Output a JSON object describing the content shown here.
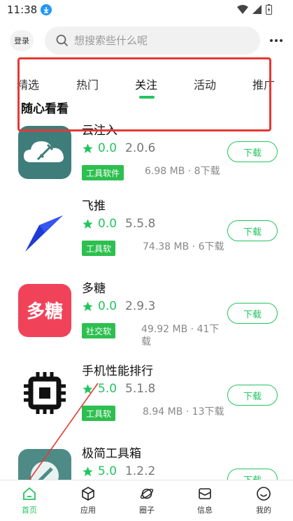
{
  "status_bar": {
    "time": "11:38"
  },
  "header": {
    "login_label": "登录",
    "search_placeholder": "想搜索些什么呢"
  },
  "tabs": [
    {
      "label": "精选",
      "active": false
    },
    {
      "label": "热门",
      "active": false
    },
    {
      "label": "关注",
      "active": true
    },
    {
      "label": "活动",
      "active": false
    },
    {
      "label": "推广",
      "active": false
    }
  ],
  "section_title": "随心看看",
  "apps": [
    {
      "name": "云注入",
      "rating": "0.0",
      "version": "2.0.6",
      "category": "工具软件",
      "meta": "6.98 MB · 8下载",
      "download_label": "下载"
    },
    {
      "name": "飞推",
      "rating": "0.0",
      "version": "5.5.8",
      "category": "工具软",
      "meta": "74.38 MB · 6下载",
      "download_label": "下载"
    },
    {
      "name": "多糖",
      "rating": "0.0",
      "version": "2.9.3",
      "category": "社交软",
      "meta": "49.92 MB · 41下载",
      "download_label": "下载"
    },
    {
      "name": "手机性能排行",
      "rating": "5.0",
      "version": "5.1.8",
      "category": "工具软",
      "meta": "8.94 MB · 13下载",
      "download_label": "下载"
    },
    {
      "name": "极简工具箱",
      "rating": "5.0",
      "version": "1.2.2",
      "category": "",
      "meta": "",
      "download_label": "下载"
    }
  ],
  "bottom_nav": [
    {
      "label": "首页",
      "icon": "home-icon",
      "active": true
    },
    {
      "label": "应用",
      "icon": "cube-icon",
      "active": false
    },
    {
      "label": "圈子",
      "icon": "planet-icon",
      "active": false
    },
    {
      "label": "信息",
      "icon": "mail-icon",
      "active": false
    },
    {
      "label": "我的",
      "icon": "smiley-icon",
      "active": false
    }
  ],
  "colors": {
    "accent": "#22c55e",
    "annotation": "#e53935"
  }
}
